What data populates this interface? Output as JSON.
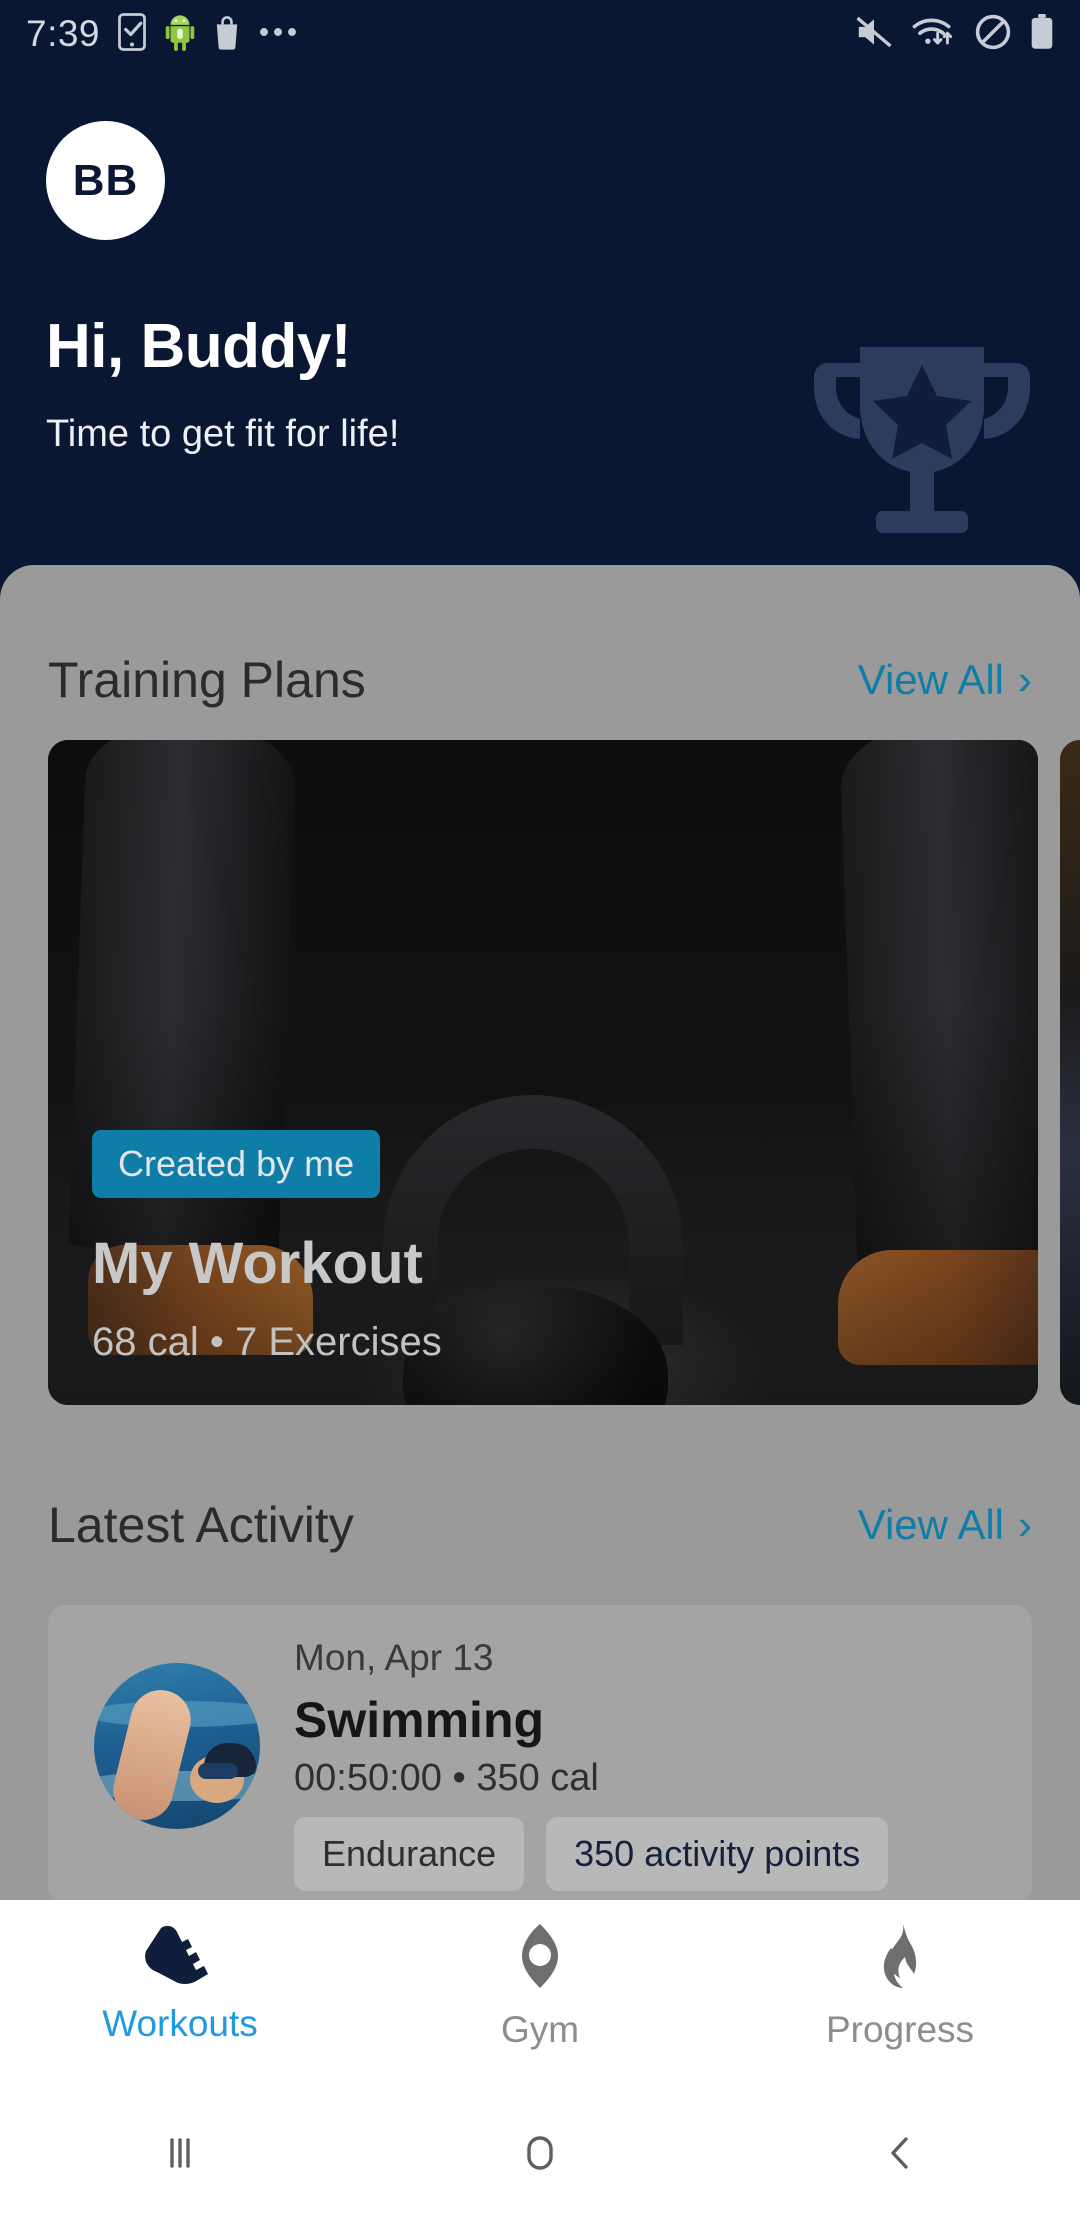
{
  "status_bar": {
    "time": "7:39",
    "left_icons": [
      "tasks-check-icon",
      "android-robot-icon",
      "shopping-bag-icon",
      "more-dots-icon"
    ],
    "right_icons": [
      "mute-icon",
      "wifi-data-icon",
      "do-not-disturb-icon",
      "battery-icon"
    ]
  },
  "header": {
    "avatar_initials": "BB",
    "greeting": "Hi, Buddy!",
    "subgreeting": "Time to get fit for life!",
    "watermark_icon": "trophy-star-icon",
    "background_color": "#0a1733"
  },
  "training_plans": {
    "title": "Training Plans",
    "view_all_label": "View All",
    "cards": [
      {
        "badge": "Created by me",
        "title": "My Workout",
        "meta": "68 cal • 7 Exercises",
        "calories": "68 cal",
        "exercises": "7 Exercises",
        "image": "kettlebell-photo"
      },
      {
        "image": "gym-photo"
      }
    ]
  },
  "latest_activity": {
    "title": "Latest Activity",
    "view_all_label": "View All",
    "items": [
      {
        "date": "Mon, Apr 13",
        "name": "Swimming",
        "meta": "00:50:00 • 350 cal",
        "duration": "00:50:00",
        "calories": "350 cal",
        "thumbnail": "swimmer-photo",
        "chips": [
          "Endurance",
          "350 activity points"
        ]
      }
    ]
  },
  "bottom_nav": {
    "items": [
      {
        "label": "Workouts",
        "icon": "running-shoe-icon",
        "active": true
      },
      {
        "label": "Gym",
        "icon": "gym-eye-icon",
        "active": false
      },
      {
        "label": "Progress",
        "icon": "flame-icon",
        "active": false
      }
    ],
    "active_color": "#1f9ae0",
    "inactive_color": "#8d8d8d"
  },
  "android_nav": {
    "recents_icon": "recents-icon",
    "home_icon": "home-icon",
    "back_icon": "back-icon"
  },
  "theme": {
    "accent": "#0e7ea8",
    "navy": "#0a1733",
    "scrim": "#9a9a9a"
  }
}
